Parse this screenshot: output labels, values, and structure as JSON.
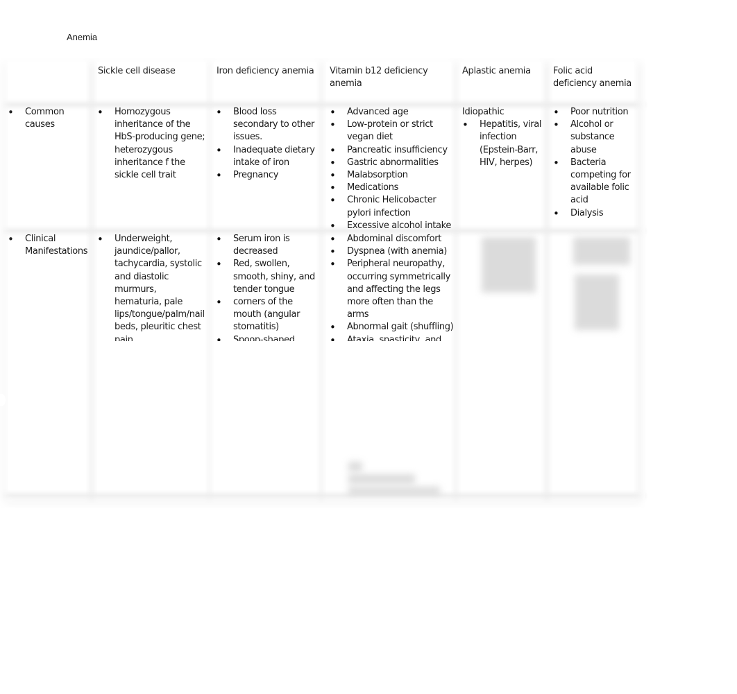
{
  "document": {
    "title": "Anemia"
  },
  "table": {
    "headers": [
      "",
      "Sickle cell disease",
      "Iron deficiency anemia",
      "Vitamin b12 deficiency anemia",
      "Aplastic anemia",
      "Folic acid deficiency anemia"
    ],
    "rows": [
      {
        "label": "Common causes",
        "cells": [
          {
            "items": [
              "Homozygous inheritance of the HbS-producing gene; heterozygous inheritance f the sickle cell trait"
            ]
          },
          {
            "items": [
              "Blood loss secondary to other issues.",
              "Inadequate dietary intake of iron",
              "Pregnancy"
            ]
          },
          {
            "items": [
              "Advanced age",
              "Low-protein or strict vegan diet",
              "Pancreatic insufficiency",
              "Gastric abnormalities",
              "Malabsorption",
              "Medications",
              "Chronic Helicobacter pylori infection",
              "Excessive alcohol intake"
            ]
          },
          {
            "lead": "Idiopathic",
            "items": [
              "Hepatitis, viral infection (Epstein-Barr, HIV, herpes)"
            ]
          },
          {
            "items": [
              "Poor nutrition",
              "Alcohol or substance abuse",
              "Bacteria competing for available folic acid",
              "Dialysis"
            ]
          }
        ]
      },
      {
        "label": "Clinical Manifestations",
        "cells": [
          {
            "items": [
              "Underweight, jaundice/pallor, tachycardia, systolic and diastolic murmurs, hematuria, pale lips/tongue/palm/nail beds, pleuritic chest pain"
            ]
          },
          {
            "items": [
              "Serum iron is decreased",
              "Red, swollen, smooth, shiny, and tender tongue",
              "corners of the mouth (angular stomatitis)",
              "Spoon-shaped"
            ]
          },
          {
            "items": [
              "Abdominal discomfort",
              "Dyspnea (with anemia)",
              "Peripheral neuropathy, occurring symmetrically and affecting the legs more often than the arms",
              "Abnormal gait (shuffling)",
              "Ataxia, spasticity, and"
            ]
          },
          {
            "items": []
          },
          {
            "items": []
          }
        ]
      }
    ]
  }
}
